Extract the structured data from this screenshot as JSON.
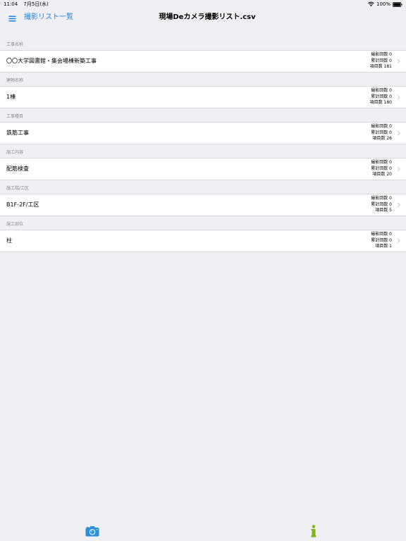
{
  "status_bar": {
    "time": "11:04",
    "date": "7月5日(水)",
    "battery": "100%",
    "wifi_icon": "wifi-icon",
    "battery_icon": "battery-icon"
  },
  "nav": {
    "menu_icon": "hamburger-menu-icon",
    "back_label": "撮影リスト一覧",
    "title": "現場Deカメラ撮影リスト.csv"
  },
  "stat_labels": {
    "shots": "撮影回数",
    "total": "累計回数",
    "items": "項目数"
  },
  "sections": [
    {
      "header": "工事名称",
      "value": "〇〇大学図書館・集会場棟新築工事",
      "shots": "0",
      "total": "0",
      "items": "181"
    },
    {
      "header": "建物名称",
      "value": "1棟",
      "shots": "0",
      "total": "0",
      "items": "180"
    },
    {
      "header": "工事種目",
      "value": "鉄筋工事",
      "shots": "0",
      "total": "0",
      "items": "26"
    },
    {
      "header": "施工内容",
      "value": "配筋検査",
      "shots": "0",
      "total": "0",
      "items": "20"
    },
    {
      "header": "施工階/工区",
      "value": "B1F-2F/工区",
      "shots": "0",
      "total": "0",
      "items": "5"
    },
    {
      "header": "施工部位",
      "value": "柱",
      "shots": "0",
      "total": "0",
      "items": "1"
    }
  ],
  "toolbar": {
    "camera_icon": "camera-icon",
    "info_icon": "info-icon"
  },
  "colors": {
    "accent": "#1a82e2",
    "info_green": "#7cb518",
    "background": "#efeff4"
  }
}
